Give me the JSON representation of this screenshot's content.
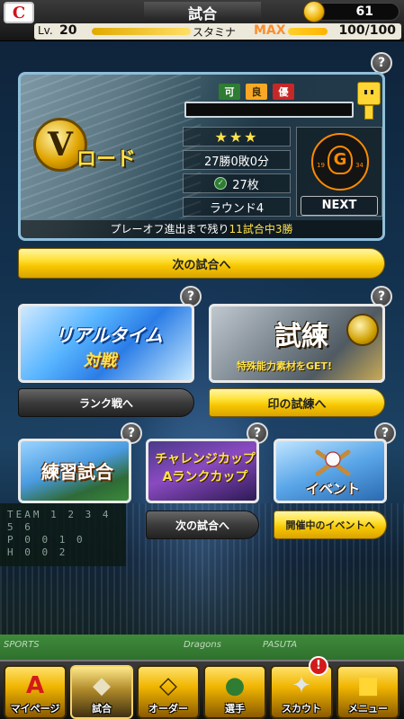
{
  "header": {
    "team_logo": "C",
    "title": "試合",
    "coins": "61",
    "level_label": "Lv.",
    "level": "20",
    "stamina_label": "スタミナ",
    "stamina_max_label": "MAX",
    "stamina_value": "100/100"
  },
  "vroad": {
    "emblem": "V",
    "title": "ロード",
    "grade_flags": [
      "可",
      "良",
      "優"
    ],
    "stars": "★★★",
    "record": "27勝0敗0分",
    "tickets": "27枚",
    "round": "ラウンド4",
    "opponent_year_left": "19",
    "opponent_year_right": "34",
    "opponent_mark": "G",
    "next_label": "NEXT",
    "playoff_prefix": "プレーオフ進出まで残り",
    "playoff_highlight": "11試合中3勝",
    "help": "?"
  },
  "buttons": {
    "next_game": "次の試合へ",
    "rank_battle": "ランク戦へ",
    "seal_trial": "印の試練へ",
    "next_game_small": "次の試合へ",
    "ongoing_events": "開催中のイベントへ"
  },
  "cards": {
    "realtime_title": "リアルタイム",
    "realtime_sub": "対戦",
    "shiren_title": "試練",
    "shiren_sub": "特殊能力素材をGET!",
    "practice_title": "練習試合",
    "challenge_title": "チャレンジカップ",
    "challenge_sub": "Aランクカップ",
    "event_title": "イベント",
    "help": "?"
  },
  "background": {
    "scoreboard_lines": [
      "TEAM 1 2 3 4 5 6",
      "P   0 0 1 0",
      "H   0 0 2"
    ],
    "wall_text": [
      "SPORTS",
      "Dragons",
      "PASUTA"
    ]
  },
  "nav": {
    "items": [
      {
        "label": "マイページ",
        "icon": "A"
      },
      {
        "label": "試合",
        "icon": "◆"
      },
      {
        "label": "オーダー",
        "icon": "◇"
      },
      {
        "label": "選手",
        "icon": "●"
      },
      {
        "label": "スカウト",
        "icon": "✦"
      },
      {
        "label": "メニュー",
        "icon": "■"
      }
    ],
    "scout_badge": "!"
  }
}
